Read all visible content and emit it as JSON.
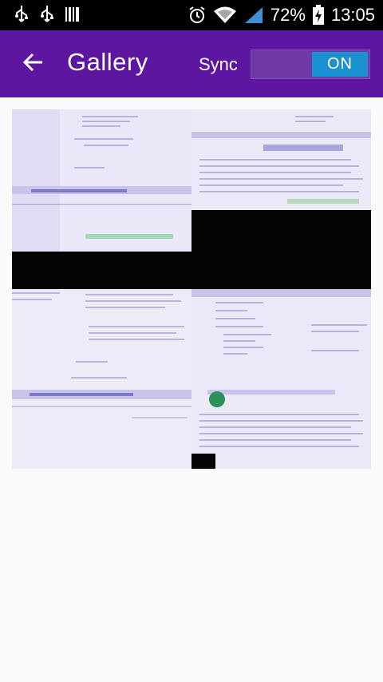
{
  "status_bar": {
    "battery": "72%",
    "time": "13:05",
    "icons": [
      "usb-icon",
      "usb-icon",
      "barcode-icon",
      "alarm-icon",
      "wifi-icon",
      "signal-icon",
      "battery-charging-icon"
    ]
  },
  "app_bar": {
    "title": "Gallery",
    "sync_label": "Sync",
    "toggle_state": "ON",
    "back_icon": "arrow-back-icon"
  },
  "gallery": {
    "photos": [
      {
        "description_icon": "photo-thumbnail"
      },
      {
        "description_icon": "photo-thumbnail"
      },
      {
        "description_icon": "photo-thumbnail"
      },
      {
        "description_icon": "photo-thumbnail"
      }
    ]
  },
  "colors": {
    "app_bar": "#5c169f",
    "toggle_on": "#1c91d1",
    "status_bar": "#000000",
    "background": "#fafafa"
  }
}
